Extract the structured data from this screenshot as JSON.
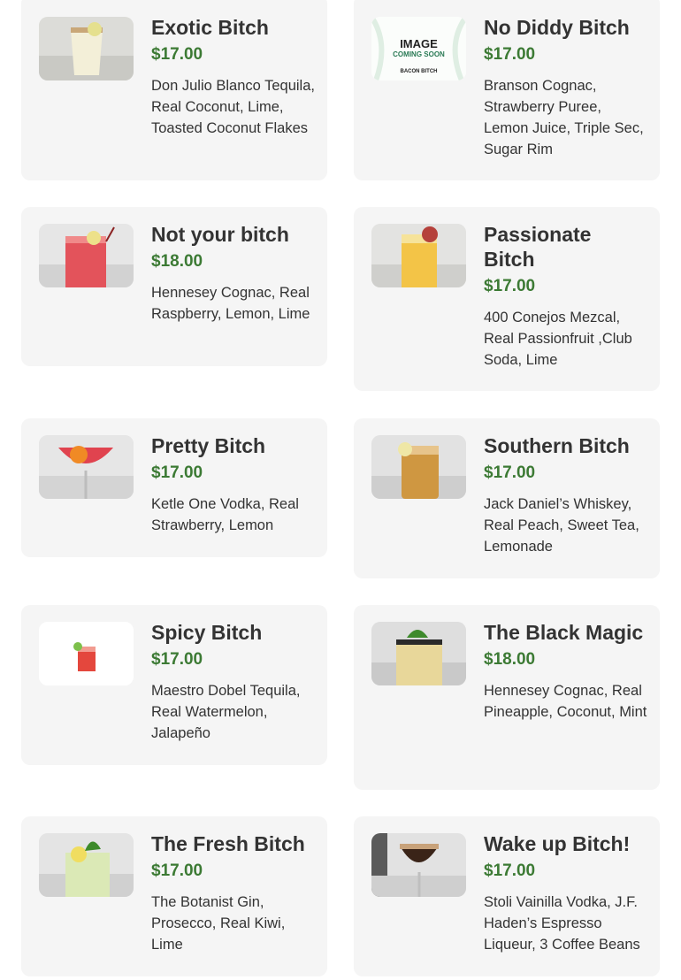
{
  "menu": {
    "items": [
      {
        "name": "Exotic Bitch",
        "price": "$17.00",
        "description": "Don Julio Blanco Tequila, Real Coconut, Lime, Toasted Coconut Flakes"
      },
      {
        "name": "No Diddy Bitch",
        "price": "$17.00",
        "description": "Branson Cognac, Strawberry Puree, Lemon Juice, Triple Sec, Sugar Rim",
        "placeholder": {
          "line1": "IMAGE",
          "line2": "COMING SOON",
          "brand": "BACON BITCH"
        }
      },
      {
        "name": "Not your bitch",
        "price": "$18.00",
        "description": "Hennesey Cognac, Real Raspberry, Lemon, Lime"
      },
      {
        "name": "Passionate Bitch",
        "price": "$17.00",
        "description": "400 Conejos Mezcal, Real Passionfruit ,Club Soda, Lime"
      },
      {
        "name": "Pretty Bitch",
        "price": "$17.00",
        "description": "Ketle One Vodka, Real Strawberry, Lemon"
      },
      {
        "name": "Southern Bitch",
        "price": "$17.00",
        "description": "Jack Daniel’s Whiskey, Real Peach, Sweet Tea, Lemonade"
      },
      {
        "name": "Spicy Bitch",
        "price": "$17.00",
        "description": "Maestro Dobel Tequila, Real Watermelon, Jalapeño"
      },
      {
        "name": "The Black Magic",
        "price": "$18.00",
        "description": "Hennesey Cognac, Real Pineapple, Coconut, Mint"
      },
      {
        "name": "The Fresh Bitch",
        "price": "$17.00",
        "description": "The Botanist Gin, Prosecco, Real Kiwi, Lime"
      },
      {
        "name": "Wake up Bitch!",
        "price": "$17.00",
        "description": "Stoli Vainilla Vodka, J.F. Haden’s Espresso Liqueur, 3 Coffee Beans"
      }
    ]
  },
  "colors": {
    "card_bg": "#f5f5f5",
    "price": "#3c7a34",
    "text": "#333333"
  }
}
